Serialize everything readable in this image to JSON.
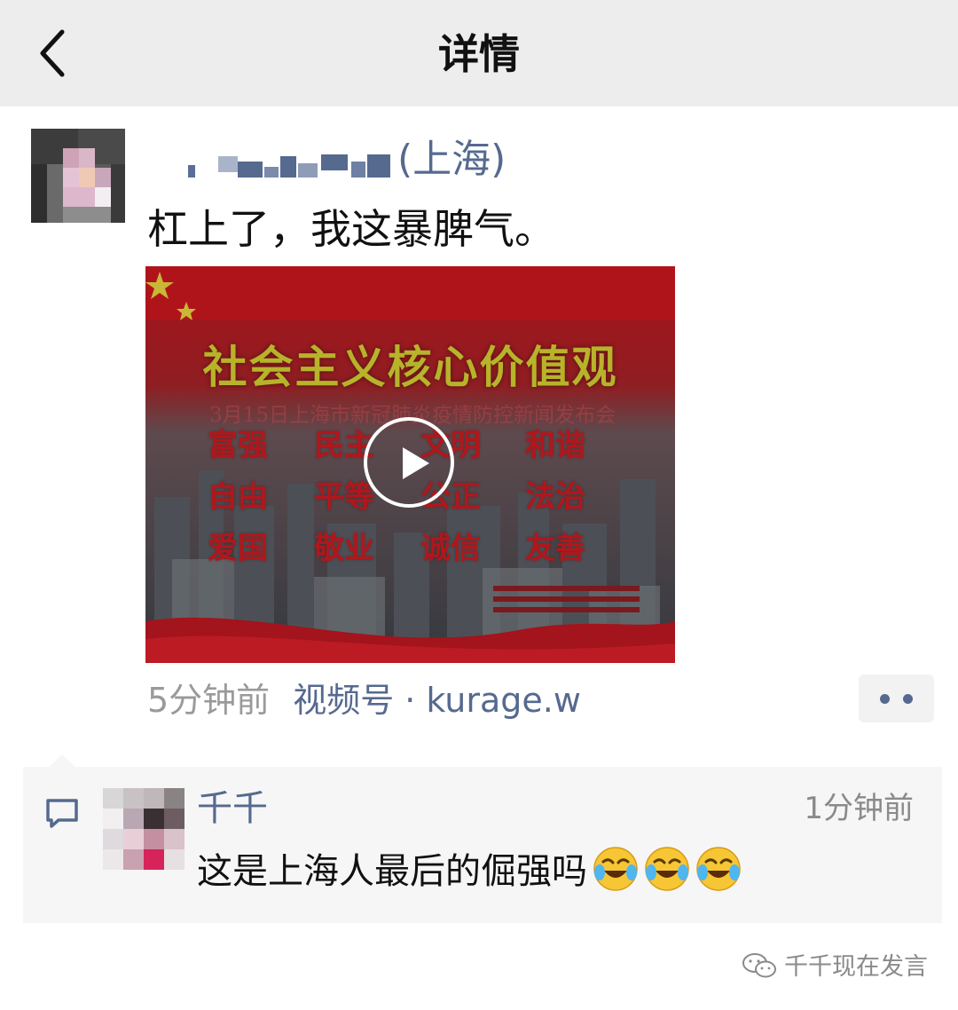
{
  "header": {
    "title": "详情",
    "back_icon": "chevron-left-icon"
  },
  "post": {
    "author_location": "(上海)",
    "text": "杠上了，我这暴脾气。",
    "video": {
      "title": "社会主义核心价值观",
      "subtitle": "3月15日上海市新冠肺炎疫情防控新闻发布会",
      "values": [
        "富强",
        "民主",
        "文明",
        "和谐",
        "自由",
        "平等",
        "公正",
        "法治",
        "爱国",
        "敬业",
        "诚信",
        "友善"
      ],
      "play_icon": "play-icon"
    },
    "time": "5分钟前",
    "source": "视频号 · kurage.w",
    "more_icon": "more-icon"
  },
  "comment": {
    "icon": "comment-icon",
    "name": "千千",
    "time": "1分钟前",
    "text": "这是上海人最后的倔强吗",
    "emoji": "crying-laughing-emoji"
  },
  "watermark": {
    "text": "千千现在发言",
    "icon": "wechat-icon"
  },
  "colors": {
    "link_blue": "#56698f",
    "header_bg": "#ededed",
    "comment_bg": "#f6f6f6",
    "video_red": "#b0171c"
  }
}
